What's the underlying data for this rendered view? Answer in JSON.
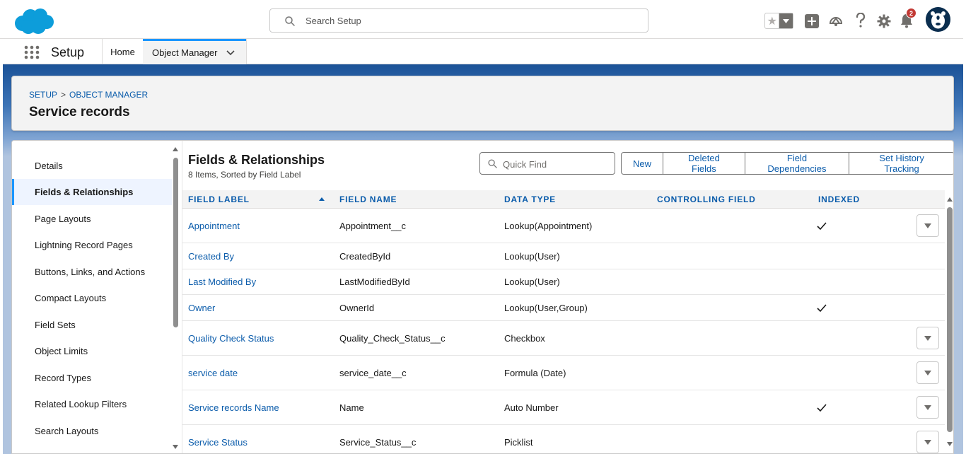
{
  "colors": {
    "brand_blue": "#1b96ff",
    "link_blue": "#0b5cab",
    "notification_red": "#c23934",
    "band_dark": "#1b5297",
    "band_light": "#b0c4df"
  },
  "header": {
    "search_placeholder": "Search Setup",
    "notification_count": "2",
    "icons": [
      "salesforce-cloud-logo",
      "favorite-star-icon",
      "add-icon",
      "trailhead-icon",
      "help-icon",
      "setup-gear-icon",
      "notification-bell-icon",
      "user-avatar"
    ]
  },
  "nav": {
    "app_name": "Setup",
    "home_tab": "Home",
    "object_manager_tab": "Object Manager"
  },
  "page_header": {
    "breadcrumb_setup": "SETUP",
    "breadcrumb_sep": ">",
    "breadcrumb_object_manager": "OBJECT MANAGER",
    "title": "Service records"
  },
  "sidebar": {
    "items": [
      {
        "label": "Details",
        "active": false
      },
      {
        "label": "Fields & Relationships",
        "active": true
      },
      {
        "label": "Page Layouts",
        "active": false
      },
      {
        "label": "Lightning Record Pages",
        "active": false
      },
      {
        "label": "Buttons, Links, and Actions",
        "active": false
      },
      {
        "label": "Compact Layouts",
        "active": false
      },
      {
        "label": "Field Sets",
        "active": false
      },
      {
        "label": "Object Limits",
        "active": false
      },
      {
        "label": "Record Types",
        "active": false
      },
      {
        "label": "Related Lookup Filters",
        "active": false
      },
      {
        "label": "Search Layouts",
        "active": false
      }
    ]
  },
  "content": {
    "title": "Fields & Relationships",
    "subtitle": "8 Items, Sorted by Field Label",
    "quick_find_placeholder": "Quick Find",
    "buttons": {
      "new": "New",
      "deleted_fields": "Deleted Fields",
      "field_dependencies": "Field Dependencies",
      "set_history_tracking": "Set History Tracking"
    }
  },
  "table": {
    "columns": {
      "field_label": "FIELD LABEL",
      "field_name": "FIELD NAME",
      "data_type": "DATA TYPE",
      "controlling_field": "CONTROLLING FIELD",
      "indexed": "INDEXED"
    },
    "sort_column": "FIELD LABEL",
    "sort_direction": "ascending",
    "rows": [
      {
        "label": "Appointment",
        "name": "Appointment__c",
        "type": "Lookup(Appointment)",
        "controlling": "",
        "indexed": true,
        "has_menu": true
      },
      {
        "label": "Created By",
        "name": "CreatedById",
        "type": "Lookup(User)",
        "controlling": "",
        "indexed": false,
        "has_menu": false
      },
      {
        "label": "Last Modified By",
        "name": "LastModifiedById",
        "type": "Lookup(User)",
        "controlling": "",
        "indexed": false,
        "has_menu": false
      },
      {
        "label": "Owner",
        "name": "OwnerId",
        "type": "Lookup(User,Group)",
        "controlling": "",
        "indexed": true,
        "has_menu": false
      },
      {
        "label": "Quality Check Status",
        "name": "Quality_Check_Status__c",
        "type": "Checkbox",
        "controlling": "",
        "indexed": false,
        "has_menu": true
      },
      {
        "label": "service date",
        "name": "service_date__c",
        "type": "Formula (Date)",
        "controlling": "",
        "indexed": false,
        "has_menu": true
      },
      {
        "label": "Service records Name",
        "name": "Name",
        "type": "Auto Number",
        "controlling": "",
        "indexed": true,
        "has_menu": true
      },
      {
        "label": "Service Status",
        "name": "Service_Status__c",
        "type": "Picklist",
        "controlling": "",
        "indexed": false,
        "has_menu": true
      }
    ]
  }
}
